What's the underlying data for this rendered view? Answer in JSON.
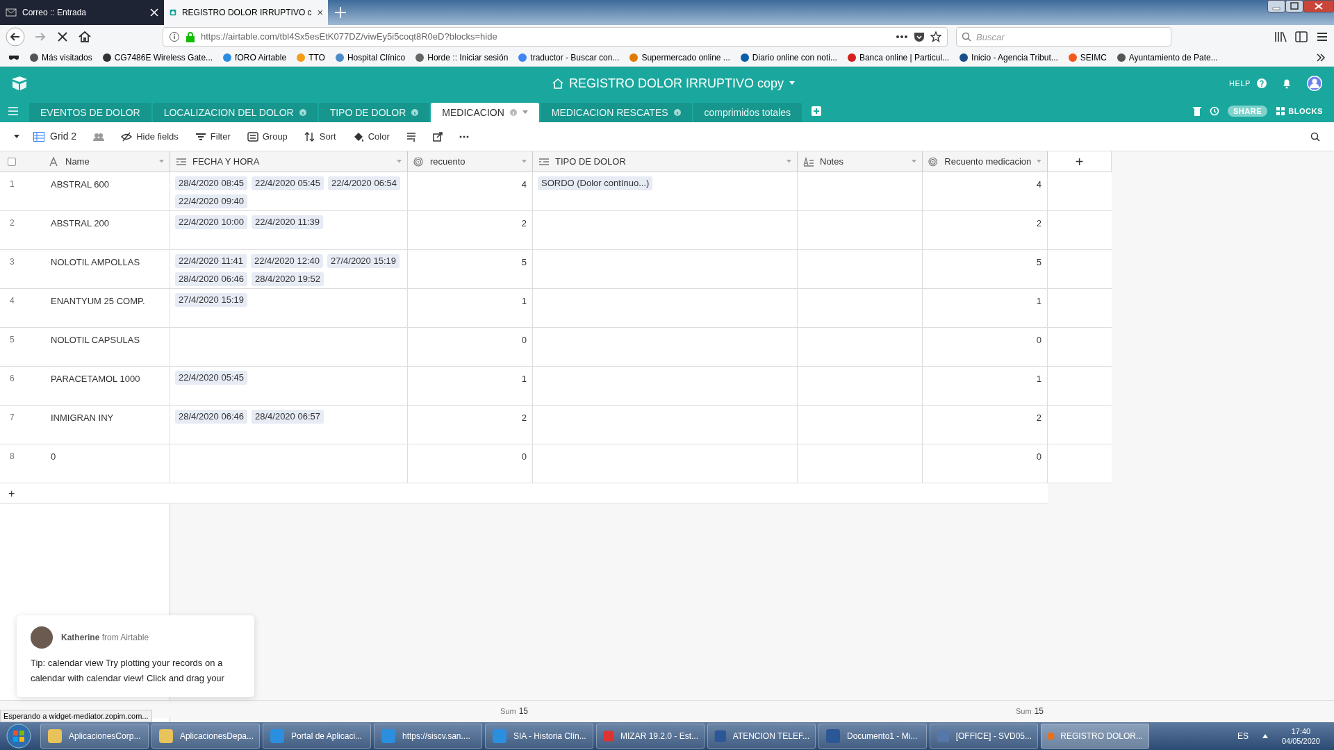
{
  "browser": {
    "tabs": [
      {
        "title": "Correo :: Entrada",
        "selected": false
      },
      {
        "title": "REGISTRO DOLOR IRRUPTIVO c",
        "selected": true
      }
    ],
    "url": "https://airtable.com/tbl4Sx5esEtK077DZ/viwEy5i5coqt8R0eD?blocks=hide",
    "search_placeholder": "Buscar",
    "bookmarks": [
      "Más visitados",
      "CG7486E Wireless Gate...",
      "fORO Airtable",
      "TTO",
      "Hospital Clínico",
      "Horde :: Iniciar sesión",
      "traductor - Buscar con...",
      "Supermercado online ...",
      "Diario online con noti...",
      "Banca online | Particul...",
      "Inicio - Agencia Tribut...",
      "SEIMC",
      "Ayuntamiento de Pate..."
    ]
  },
  "app": {
    "title": "REGISTRO DOLOR IRRUPTIVO copy",
    "help": "HELP",
    "share": "SHARE",
    "blocks": "BLOCKS",
    "tables": [
      {
        "label": "EVENTOS DE DOLOR",
        "selected": false,
        "info": false
      },
      {
        "label": "LOCALIZACION DEL DOLOR",
        "selected": false,
        "info": true
      },
      {
        "label": "TIPO DE DOLOR",
        "selected": false,
        "info": true
      },
      {
        "label": "MEDICACION",
        "selected": true,
        "info": true
      },
      {
        "label": "MEDICACION RESCATES",
        "selected": false,
        "info": true
      },
      {
        "label": "comprimidos totales",
        "selected": false,
        "info": false
      }
    ],
    "view": "Grid 2",
    "toolbar": [
      "Hide fields",
      "Filter",
      "Group",
      "Sort",
      "Color"
    ],
    "columns": [
      {
        "name": "Name",
        "kind": "text"
      },
      {
        "name": "FECHA Y HORA",
        "kind": "link"
      },
      {
        "name": "recuento",
        "kind": "count"
      },
      {
        "name": "TIPO DE DOLOR",
        "kind": "link"
      },
      {
        "name": "Notes",
        "kind": "longtext"
      },
      {
        "name": "Recuento medicacion",
        "kind": "count"
      }
    ],
    "rows": [
      {
        "num": "1",
        "name": "ABSTRAL 600",
        "dates": [
          "28/4/2020 08:45",
          "22/4/2020 05:45",
          "22/4/2020 06:54",
          "22/4/2020 09:40"
        ],
        "recuento": "4",
        "tipo": [
          "SORDO (Dolor contínuo...)"
        ],
        "recuento_med": "4"
      },
      {
        "num": "2",
        "name": "ABSTRAL 200",
        "dates": [
          "22/4/2020 10:00",
          "22/4/2020 11:39"
        ],
        "recuento": "2",
        "tipo": [],
        "recuento_med": "2"
      },
      {
        "num": "3",
        "name": "NOLOTIL AMPOLLAS",
        "dates": [
          "22/4/2020 11:41",
          "22/4/2020 12:40",
          "27/4/2020 15:19",
          "28/4/2020 06:46",
          "28/4/2020 19:52"
        ],
        "recuento": "5",
        "tipo": [],
        "recuento_med": "5"
      },
      {
        "num": "4",
        "name": "ENANTYUM 25 COMP.",
        "dates": [
          "27/4/2020 15:19"
        ],
        "recuento": "1",
        "tipo": [],
        "recuento_med": "1"
      },
      {
        "num": "5",
        "name": "NOLOTIL CAPSULAS",
        "dates": [],
        "recuento": "0",
        "tipo": [],
        "recuento_med": "0"
      },
      {
        "num": "6",
        "name": "PARACETAMOL 1000",
        "dates": [
          "22/4/2020 05:45"
        ],
        "recuento": "1",
        "tipo": [],
        "recuento_med": "1"
      },
      {
        "num": "7",
        "name": "INMIGRAN INY",
        "dates": [
          "28/4/2020 06:46",
          "28/4/2020 06:57"
        ],
        "recuento": "2",
        "tipo": [],
        "recuento_med": "2"
      },
      {
        "num": "8",
        "name": "0",
        "dates": [],
        "recuento": "0",
        "tipo": [],
        "recuento_med": "0"
      }
    ],
    "select_all": {
      "checked": false
    },
    "add_row": "+",
    "add_column": "+",
    "sums": [
      {
        "label": "Sum",
        "value": "15"
      },
      {
        "label": "Sum",
        "value": "15"
      }
    ]
  },
  "chat": {
    "agent": "Katherine",
    "from": "from Airtable",
    "message": "Tip: calendar view Try plotting your records on a calendar with calendar view! Click and drag your"
  },
  "status_text": "Esperando a widget-mediator.zopim.com...",
  "taskbar": [
    "AplicacionesCorp...",
    "AplicacionesDepa...",
    "Portal de Aplicaci...",
    "https://siscv.san....",
    "SIA - Historia Clín...",
    "MIZAR 19.2.0 - Est...",
    "ATENCION TELEF...",
    "Documento1 - Mi...",
    "[OFFICE] - SVD05...",
    "REGISTRO DOLOR..."
  ],
  "tray": {
    "lang": "ES",
    "time": "17:40",
    "date": "04/05/2020"
  }
}
